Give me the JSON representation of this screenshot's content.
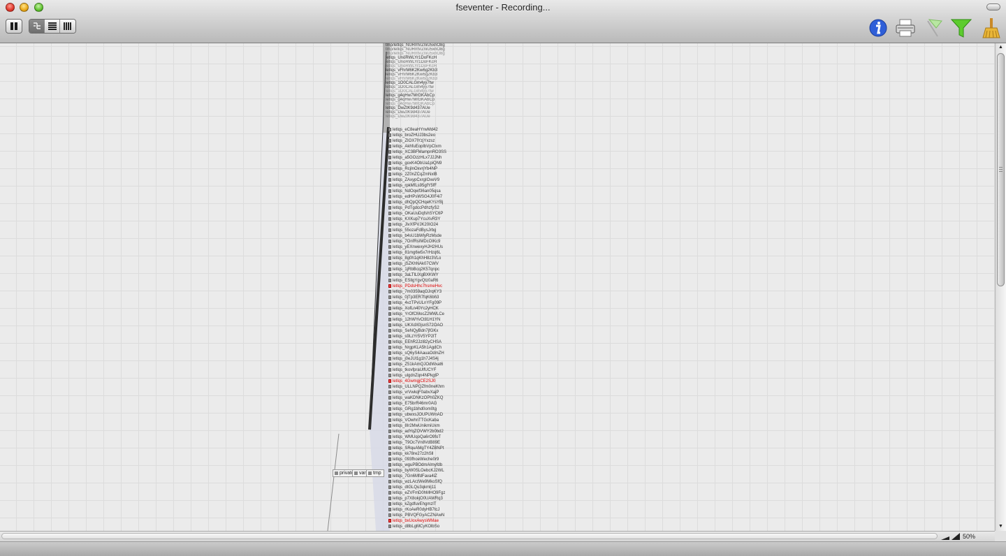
{
  "window": {
    "title": "fseventer - Recording..."
  },
  "toolbar": {
    "pause": "pause-icon",
    "view_modes": [
      "tree-view-icon",
      "list-view-icon",
      "column-view-icon"
    ],
    "active_view": 0,
    "right_icons": [
      "info-icon",
      "print-icon",
      "flag-icon",
      "funnel-icon",
      "broom-icon"
    ]
  },
  "tree": {
    "directories": [
      "private",
      "var",
      "tmp"
    ],
    "stacked_top": [
      "tmp/letlqs_NURmVZniU5xnO8g",
      "letlqs_UnoRWLYr1DoFKcH",
      "letlqs_vFhrM6K2Kw6g2Kb3",
      "letlqs_1O0CALGm4yy7tw",
      "letlqs_g4qHw7MrGKAbCp",
      "letlqs_DwZtK9d437AUe"
    ],
    "files": [
      {
        "name": "letlqs_eC8eaHYrwMd42",
        "changed": false
      },
      {
        "name": "letlqs_broZHUJ3bs2eo",
        "changed": false
      },
      {
        "name": "letlqs_ZIOX7lYzjYxzsz",
        "changed": false
      },
      {
        "name": "letlqs_AkhfuEopIbVpCIxm",
        "changed": false
      },
      {
        "name": "letlqs_XC3BFMampnRO3SS",
        "changed": false
      },
      {
        "name": "letlqs_a5GOzzHLx7J2JNh",
        "changed": false
      },
      {
        "name": "letlqs_goxK4ObUa1piQN9",
        "changed": false
      },
      {
        "name": "letlqs_RcjInOxvrjYb4NP",
        "changed": false
      },
      {
        "name": "letlqs_2Z0nZCqZmNxlB",
        "changed": false
      },
      {
        "name": "letlqs_ZAxypCxrgIOxeV9",
        "changed": false
      },
      {
        "name": "letlqs_rpkMfLs95gfY5fF",
        "changed": false
      },
      {
        "name": "letlqs_NdOqwf36an05qsa",
        "changed": false
      },
      {
        "name": "letlqs_edHPsWSG4J0F4i7",
        "changed": false
      },
      {
        "name": "letlqs_dhQpQCHqeKYsYBj",
        "changed": false
      },
      {
        "name": "letlqs_PdTgdccPdhzfyS2",
        "changed": false
      },
      {
        "name": "letlqs_OKaUuDqfshSYC6P",
        "changed": false
      },
      {
        "name": "letlqs_KXKup7YcuXvR3Y",
        "changed": false
      },
      {
        "name": "letlqs_JlvXfPVJK20IO24",
        "changed": false
      },
      {
        "name": "letlqs_55ozaFdBysJrbg",
        "changed": false
      },
      {
        "name": "letlqs_b4sU1bWlyRzMsde",
        "changed": false
      },
      {
        "name": "letlqs_7OnfRsIMDcOIKc9",
        "changed": false
      },
      {
        "name": "letlqs_yEXnwexyHJH2HUs",
        "changed": false
      },
      {
        "name": "letlqs_81mg6w5x7rHzq6L",
        "changed": false
      },
      {
        "name": "letlqs_8g0h1qKhH8z3VLo",
        "changed": false
      },
      {
        "name": "letlqs_jSZKhNAk07CWV",
        "changed": false
      },
      {
        "name": "letlqs_1jRbBcq2K57qnpc",
        "changed": false
      },
      {
        "name": "letlqs_3aLTlLlXgBXKWY",
        "changed": false
      },
      {
        "name": "letlqs_ESllgYgvQtz0aR6",
        "changed": false
      },
      {
        "name": "letlqs_PDdsHhc7hsmeHvc",
        "changed": true
      },
      {
        "name": "letlqs_7m0359aqOJrqKY3",
        "changed": false
      },
      {
        "name": "letlqs_0jTp3ER7fqK6bh3",
        "changed": false
      },
      {
        "name": "letlqs_4vzTPvULnYFg09P",
        "changed": false
      },
      {
        "name": "letlqs_XofLn40Yc2yHCK",
        "changed": false
      },
      {
        "name": "letlqs_YrOfCMocZ2MWLCe",
        "changed": false
      },
      {
        "name": "letlqs_12hWYvCt81H1YN",
        "changed": false
      },
      {
        "name": "letlqs_UKXdX0jsnS72OAO",
        "changed": false
      },
      {
        "name": "letlqs_SeNQyBdn7jfGKx",
        "changed": false
      },
      {
        "name": "letlqs_s9LzYr5V5YP2lT",
        "changed": false
      },
      {
        "name": "letlqs_EEhR2Jzl82yCHSA",
        "changed": false
      },
      {
        "name": "letlqs_NrgpKLA5h1AgdCh",
        "changed": false
      },
      {
        "name": "letlqs_sQ6yS4AauaOdmZH",
        "changed": false
      },
      {
        "name": "letlqs_j0eJUl1g1h7J4S4j",
        "changed": false
      },
      {
        "name": "letlqs_Z51kAmQJOdWxat6",
        "changed": false
      },
      {
        "name": "letlqs_tkovfpraUlfUCYF",
        "changed": false
      },
      {
        "name": "letlqs_ulgdnZqn4NPkgtP",
        "changed": false
      },
      {
        "name": "letlqs_4GwmgjCE2SJ0",
        "changed": true
      },
      {
        "name": "letlqs_ULLNPQZfm0neKhm",
        "changed": false
      },
      {
        "name": "letlqs_vrVwkqF0abvXajP",
        "changed": false
      },
      {
        "name": "letlqs_waKDNKzOPh0ZKQ",
        "changed": false
      },
      {
        "name": "letlqs_E75brR46mr0AG",
        "changed": false
      },
      {
        "name": "letlqs_GRg1bhd0om0tg",
        "changed": false
      },
      {
        "name": "letlqs_ubwxsJOUPUWnAD",
        "changed": false
      },
      {
        "name": "letlqs_VOwhnTTGcKaba",
        "changed": false
      },
      {
        "name": "letlqs_8Ir2MwUnikmiUxm",
        "changed": false
      },
      {
        "name": "letlqs_adYqZOVWY2b0bd2",
        "changed": false
      },
      {
        "name": "letlqs_WMUqoQa6rO9foT",
        "changed": false
      },
      {
        "name": "letlqs_T9Oc7Vn8VdB89E",
        "changed": false
      },
      {
        "name": "letlqs_SRquAMgTY4ZBNPt",
        "changed": false
      },
      {
        "name": "letlqs_kk78re27z2hSll",
        "changed": false
      },
      {
        "name": "letlqs_093fhoeWeche0r9",
        "changed": false
      },
      {
        "name": "letlqs_wguPBOdmAlmyfdb",
        "changed": false
      },
      {
        "name": "letlqs_byW0SLOebcKJ2WL",
        "changed": false
      },
      {
        "name": "letlqs_7Gn6MfdFava4lZ",
        "changed": false
      },
      {
        "name": "letlqs_wzLArzWe9MkoSfQ",
        "changed": false
      },
      {
        "name": "letlqs_dtGLQu3qkmlj11",
        "changed": false
      },
      {
        "name": "letlqs_eZVFmD0hMHO9Fgz",
        "changed": false
      },
      {
        "name": "letlqs_p7X8okjO0UAWRq3",
        "changed": false
      },
      {
        "name": "letlqs_kZgdfuvEhgmzlT",
        "changed": false
      },
      {
        "name": "letlqs_rKoAeR0dyHB7tcJ",
        "changed": false
      },
      {
        "name": "letlqs_PBVQFGyACZNAwN",
        "changed": false
      },
      {
        "name": "letlqs_bxUoxAwysWMae",
        "changed": true
      },
      {
        "name": "letlqs_d8bLgMCyKOlbSo",
        "changed": false
      }
    ]
  },
  "statusbar": {
    "zoom": "50%"
  }
}
